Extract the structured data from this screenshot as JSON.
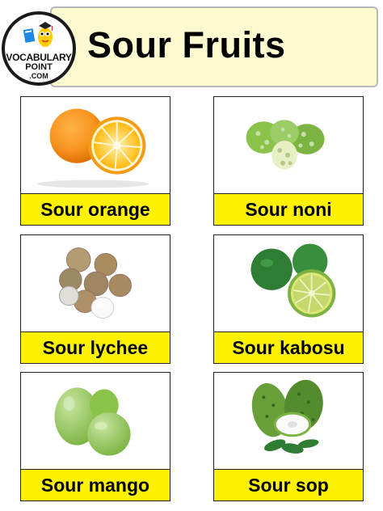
{
  "header": {
    "title": "Sour Fruits",
    "logo": {
      "line1": "VOCABULARY",
      "line2": "POINT",
      "line3": ".COM"
    }
  },
  "colors": {
    "header_bg": "#fffbd0",
    "label_bg": "#fff200",
    "border": "#222222"
  },
  "fruits": [
    {
      "label": "Sour orange",
      "icon": "orange-image"
    },
    {
      "label": "Sour noni",
      "icon": "noni-image"
    },
    {
      "label": "Sour lychee",
      "icon": "lychee-image"
    },
    {
      "label": "Sour kabosu",
      "icon": "kabosu-image"
    },
    {
      "label": "Sour mango",
      "icon": "mango-image"
    },
    {
      "label": "Sour sop",
      "icon": "soursop-image"
    }
  ]
}
